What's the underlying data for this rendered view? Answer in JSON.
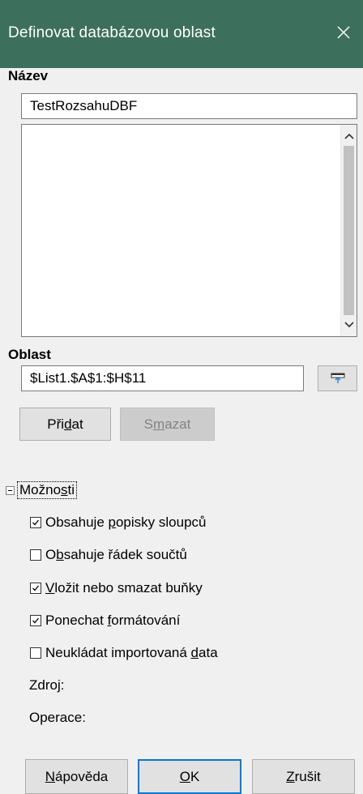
{
  "window": {
    "title": "Definovat databázovou oblast",
    "close_symbol": "✕"
  },
  "name_section": {
    "label": "Název",
    "value": "TestRozsahuDBF",
    "list_items": []
  },
  "range_section": {
    "label": "Oblast",
    "value": "$List1.$A$1:$H$11"
  },
  "buttons": {
    "add": {
      "pre": "Při",
      "accel": "d",
      "post": "at"
    },
    "delete": {
      "pre": "S",
      "accel": "m",
      "post": "azat"
    }
  },
  "options": {
    "label_pre": "Možno",
    "label_accel": "s",
    "label_post": "ti",
    "checkboxes": [
      {
        "pre": "Obsahuje ",
        "accel": "p",
        "post": "opisky sloupců",
        "checked": true
      },
      {
        "pre": "O",
        "accel": "b",
        "post": "sahuje řádek součtů",
        "checked": false
      },
      {
        "pre": "",
        "accel": "V",
        "post": "ložit nebo smazat buňky",
        "checked": true
      },
      {
        "pre": "Ponechat ",
        "accel": "f",
        "post": "ormátování",
        "checked": true
      },
      {
        "pre": "Neukládat importovaná ",
        "accel": "d",
        "post": "ata",
        "checked": false
      }
    ],
    "source_label": "Zdroj:",
    "operation_label": "Operace:"
  },
  "footer": {
    "help": {
      "pre": "",
      "accel": "N",
      "post": "ápověda"
    },
    "ok": {
      "pre": "",
      "accel": "O",
      "post": "K"
    },
    "cancel": {
      "pre": "",
      "accel": "Z",
      "post": "rušit"
    }
  },
  "colors": {
    "titlebar": "#3d6f5d",
    "focus_border": "#0078d7"
  }
}
